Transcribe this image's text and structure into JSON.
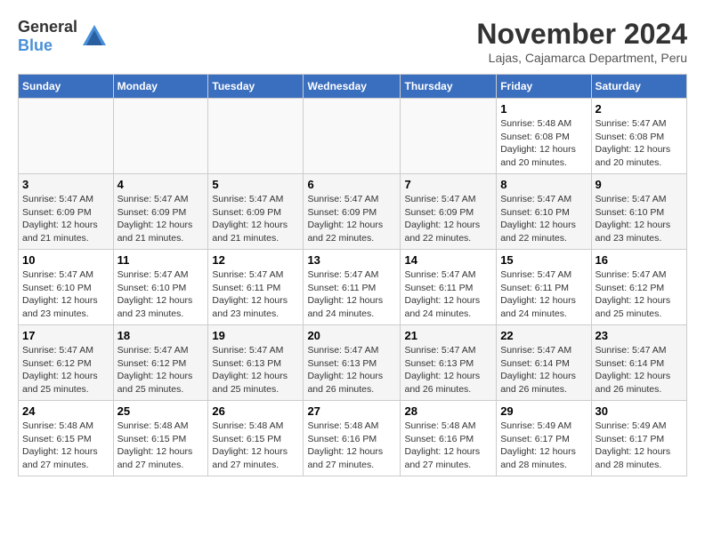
{
  "header": {
    "logo_general": "General",
    "logo_blue": "Blue",
    "month_title": "November 2024",
    "location": "Lajas, Cajamarca Department, Peru"
  },
  "days_of_week": [
    "Sunday",
    "Monday",
    "Tuesday",
    "Wednesday",
    "Thursday",
    "Friday",
    "Saturday"
  ],
  "weeks": [
    [
      {
        "day": "",
        "info": ""
      },
      {
        "day": "",
        "info": ""
      },
      {
        "day": "",
        "info": ""
      },
      {
        "day": "",
        "info": ""
      },
      {
        "day": "",
        "info": ""
      },
      {
        "day": "1",
        "info": "Sunrise: 5:48 AM\nSunset: 6:08 PM\nDaylight: 12 hours and 20 minutes."
      },
      {
        "day": "2",
        "info": "Sunrise: 5:47 AM\nSunset: 6:08 PM\nDaylight: 12 hours and 20 minutes."
      }
    ],
    [
      {
        "day": "3",
        "info": "Sunrise: 5:47 AM\nSunset: 6:09 PM\nDaylight: 12 hours and 21 minutes."
      },
      {
        "day": "4",
        "info": "Sunrise: 5:47 AM\nSunset: 6:09 PM\nDaylight: 12 hours and 21 minutes."
      },
      {
        "day": "5",
        "info": "Sunrise: 5:47 AM\nSunset: 6:09 PM\nDaylight: 12 hours and 21 minutes."
      },
      {
        "day": "6",
        "info": "Sunrise: 5:47 AM\nSunset: 6:09 PM\nDaylight: 12 hours and 22 minutes."
      },
      {
        "day": "7",
        "info": "Sunrise: 5:47 AM\nSunset: 6:09 PM\nDaylight: 12 hours and 22 minutes."
      },
      {
        "day": "8",
        "info": "Sunrise: 5:47 AM\nSunset: 6:10 PM\nDaylight: 12 hours and 22 minutes."
      },
      {
        "day": "9",
        "info": "Sunrise: 5:47 AM\nSunset: 6:10 PM\nDaylight: 12 hours and 23 minutes."
      }
    ],
    [
      {
        "day": "10",
        "info": "Sunrise: 5:47 AM\nSunset: 6:10 PM\nDaylight: 12 hours and 23 minutes."
      },
      {
        "day": "11",
        "info": "Sunrise: 5:47 AM\nSunset: 6:10 PM\nDaylight: 12 hours and 23 minutes."
      },
      {
        "day": "12",
        "info": "Sunrise: 5:47 AM\nSunset: 6:11 PM\nDaylight: 12 hours and 23 minutes."
      },
      {
        "day": "13",
        "info": "Sunrise: 5:47 AM\nSunset: 6:11 PM\nDaylight: 12 hours and 24 minutes."
      },
      {
        "day": "14",
        "info": "Sunrise: 5:47 AM\nSunset: 6:11 PM\nDaylight: 12 hours and 24 minutes."
      },
      {
        "day": "15",
        "info": "Sunrise: 5:47 AM\nSunset: 6:11 PM\nDaylight: 12 hours and 24 minutes."
      },
      {
        "day": "16",
        "info": "Sunrise: 5:47 AM\nSunset: 6:12 PM\nDaylight: 12 hours and 25 minutes."
      }
    ],
    [
      {
        "day": "17",
        "info": "Sunrise: 5:47 AM\nSunset: 6:12 PM\nDaylight: 12 hours and 25 minutes."
      },
      {
        "day": "18",
        "info": "Sunrise: 5:47 AM\nSunset: 6:12 PM\nDaylight: 12 hours and 25 minutes."
      },
      {
        "day": "19",
        "info": "Sunrise: 5:47 AM\nSunset: 6:13 PM\nDaylight: 12 hours and 25 minutes."
      },
      {
        "day": "20",
        "info": "Sunrise: 5:47 AM\nSunset: 6:13 PM\nDaylight: 12 hours and 26 minutes."
      },
      {
        "day": "21",
        "info": "Sunrise: 5:47 AM\nSunset: 6:13 PM\nDaylight: 12 hours and 26 minutes."
      },
      {
        "day": "22",
        "info": "Sunrise: 5:47 AM\nSunset: 6:14 PM\nDaylight: 12 hours and 26 minutes."
      },
      {
        "day": "23",
        "info": "Sunrise: 5:47 AM\nSunset: 6:14 PM\nDaylight: 12 hours and 26 minutes."
      }
    ],
    [
      {
        "day": "24",
        "info": "Sunrise: 5:48 AM\nSunset: 6:15 PM\nDaylight: 12 hours and 27 minutes."
      },
      {
        "day": "25",
        "info": "Sunrise: 5:48 AM\nSunset: 6:15 PM\nDaylight: 12 hours and 27 minutes."
      },
      {
        "day": "26",
        "info": "Sunrise: 5:48 AM\nSunset: 6:15 PM\nDaylight: 12 hours and 27 minutes."
      },
      {
        "day": "27",
        "info": "Sunrise: 5:48 AM\nSunset: 6:16 PM\nDaylight: 12 hours and 27 minutes."
      },
      {
        "day": "28",
        "info": "Sunrise: 5:48 AM\nSunset: 6:16 PM\nDaylight: 12 hours and 27 minutes."
      },
      {
        "day": "29",
        "info": "Sunrise: 5:49 AM\nSunset: 6:17 PM\nDaylight: 12 hours and 28 minutes."
      },
      {
        "day": "30",
        "info": "Sunrise: 5:49 AM\nSunset: 6:17 PM\nDaylight: 12 hours and 28 minutes."
      }
    ]
  ]
}
